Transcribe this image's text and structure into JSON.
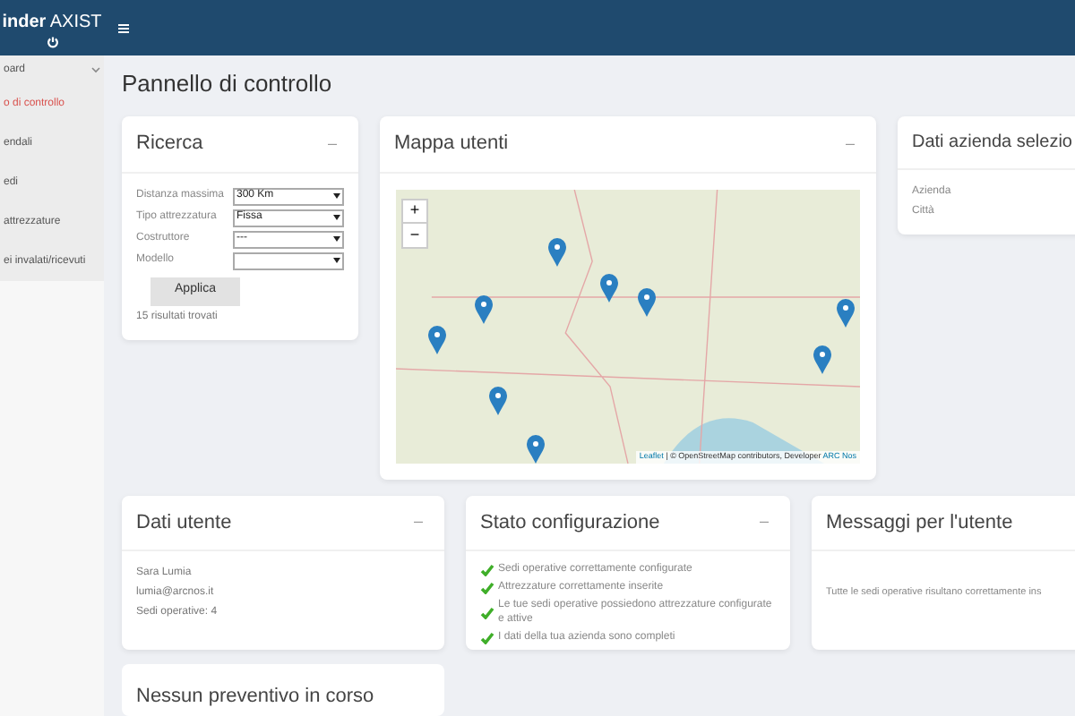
{
  "brand": {
    "bold": "inder",
    "rest": "AXIST"
  },
  "sidebar": {
    "group": {
      "label": "oard",
      "expanded": true
    },
    "items": [
      {
        "label": "o di controllo",
        "selected": true
      },
      {
        "label": "endali",
        "selected": false
      },
      {
        "label": "edi",
        "selected": false
      },
      {
        "label": "attrezzature",
        "selected": false
      },
      {
        "label": "ei invalati/ricevuti",
        "selected": false
      }
    ]
  },
  "page_title": "Pannello di controllo",
  "search_card": {
    "title": "Ricerca",
    "collapse": "–",
    "fields": [
      {
        "label": "Distanza massima",
        "value": "300 Km"
      },
      {
        "label": "Tipo attrezzatura",
        "value": "Fissa"
      },
      {
        "label": "Costruttore",
        "value": "---"
      },
      {
        "label": "Modello"
      }
    ],
    "button": "Applica",
    "result": "15 risultati trovati"
  },
  "map_card": {
    "title": "Mappa utenti",
    "collapse": "–",
    "zoom_in": "+",
    "zoom_out": "−",
    "attribution_link": "Leaflet",
    "attribution_text": "| © OpenStreetMap contributors, Developer",
    "attribution_dev": "ARC Nos"
  },
  "company_card": {
    "title": "Dati azienda selezio",
    "fields": [
      "Azienda",
      "Città"
    ]
  },
  "user_card": {
    "title": "Dati utente",
    "collapse": "–",
    "lines": [
      "Sara Lumia",
      "lumia@arcnos.it",
      "Sedi operative: 4"
    ]
  },
  "config_card": {
    "title": "Stato configurazione",
    "collapse": "–",
    "items": [
      {
        "text": "Sedi operative correttamente configurate",
        "ok": true
      },
      {
        "text": "Attrezzature correttamente inserite",
        "ok": true
      },
      {
        "text": "Le tue sedi operative possiedono attrezzature configurate e attive",
        "ok": true
      },
      {
        "text": "I dati della tua azienda sono completi",
        "ok": true
      }
    ]
  },
  "messages_card": {
    "title": "Messaggi per l'utente",
    "text": "Tutte le sedi operative risultano correttamente ins"
  },
  "quotes_card": {
    "title": "Nessun preventivo in corso"
  }
}
